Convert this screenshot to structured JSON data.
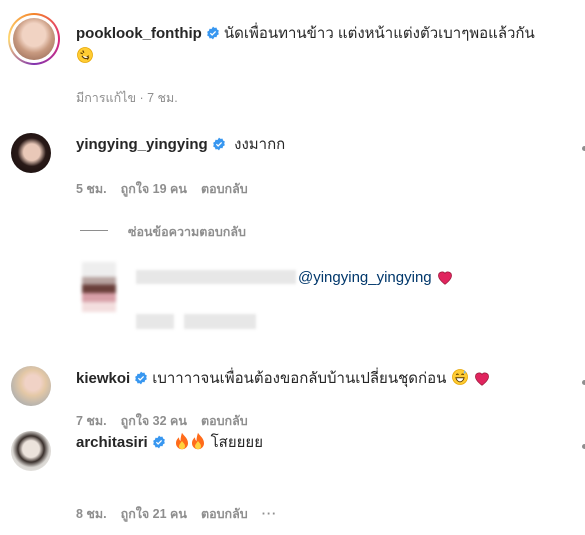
{
  "post": {
    "username": "pooklook_fonthip",
    "caption": "นัดเพื่อนทานข้าว แต่งหน้าแต่งตัวเบาๆพอแล้วกัน",
    "caption_emoji": "rolling-on-floor-laughing-emoji",
    "meta": "มีการแก้ไข · 7 ชม."
  },
  "comments": [
    {
      "username": "yingying_yingying",
      "text": "งงมากก",
      "time": "5 ชม.",
      "likes": "ถูกใจ 19 คน",
      "reply": "ตอบกลับ"
    },
    {
      "username": "kiewkoi",
      "text": "เบาาาาจนเพื่อนต้องขอกลับบ้านเปลี่ยนชุดก่อน",
      "time": "7 ชม.",
      "likes": "ถูกใจ 32 คน",
      "reply": "ตอบกลับ"
    },
    {
      "username": "architasiri",
      "text": "โสยยยย",
      "time": "8 ชม.",
      "likes": "ถูกใจ 21 คน",
      "reply": "ตอบกลับ",
      "more": "···"
    }
  ],
  "replies_toggle": "ซ่อนข้อความตอบกลับ",
  "reply": {
    "mention": "@yingying_yingying"
  },
  "colors": {
    "verified": "#3897f0",
    "muted": "#8e8e8e",
    "link": "#00376b",
    "heart": "#e0245e"
  }
}
